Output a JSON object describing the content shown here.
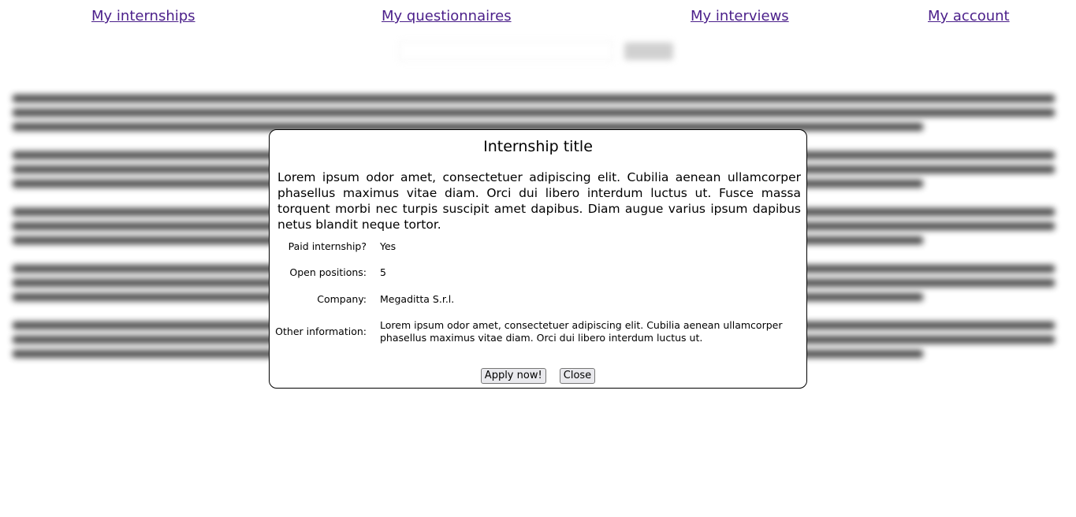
{
  "nav": {
    "internships": "My internships",
    "questionnaires": "My questionnaires",
    "interviews": "My interviews",
    "account": "My account"
  },
  "modal": {
    "title": "Internship title",
    "description": "Lorem ipsum odor amet, consectetuer adipiscing elit. Cubilia aenean ullamcorper phasellus maximus vitae diam. Orci dui libero interdum luctus ut. Fusce massa torquent morbi nec turpis suscipit amet dapibus. Diam augue varius ipsum dapibus netus blandit neque tortor.",
    "fields": [
      {
        "label": "Paid internship?",
        "value": "Yes"
      },
      {
        "label": "Open positions:",
        "value": "5"
      },
      {
        "label": "Company:",
        "value": "Megaditta S.r.l."
      },
      {
        "label": "Other information:",
        "value": "Lorem ipsum odor amet, consectetuer adipiscing elit. Cubilia aenean ullamcorper phasellus maximus vitae diam. Orci dui libero interdum luctus ut."
      }
    ],
    "apply_label": "Apply now!",
    "close_label": "Close"
  }
}
